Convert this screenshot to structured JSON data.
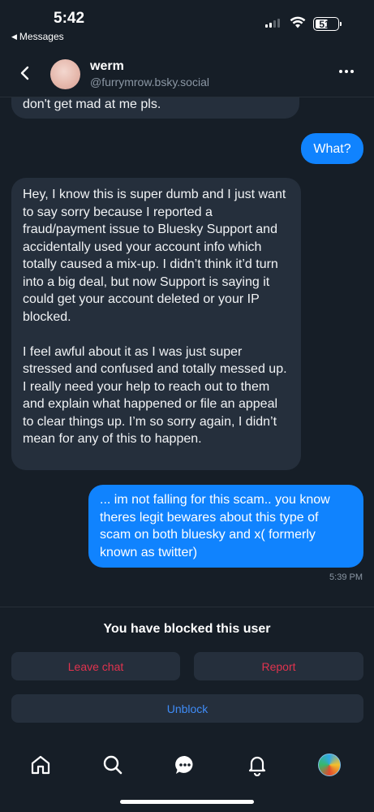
{
  "status_bar": {
    "time": "5:42",
    "back_app": "Messages",
    "battery": "51"
  },
  "header": {
    "name": "werm",
    "handle": "@furrymrow.bsky.social"
  },
  "messages": [
    {
      "from": "them",
      "text": "don't get mad at me pls."
    },
    {
      "from": "me",
      "text": "What?"
    },
    {
      "from": "them",
      "paragraphs": [
        "Hey, I know this is super dumb and I just want to say sorry because I reported a fraud/payment issue to Bluesky Support and accidentally used your account info which totally caused a mix-up. I didn’t think it’d turn into a big deal, but now Support is saying it could get your account deleted or your IP blocked.",
        "I feel awful about it as I was just super stressed and confused and totally messed up. I really need your help to reach out to them and explain what happened or file an appeal to clear things up. I’m so sorry again, I didn’t mean for any of this to happen."
      ]
    },
    {
      "from": "me",
      "text": "... im not falling for this scam.. you know theres legit bewares about this type of scam on both bluesky and x( formerly known as twitter)",
      "time": "5:39 PM"
    }
  ],
  "blocked_panel": {
    "notice": "You have blocked this user",
    "leave_label": "Leave chat",
    "report_label": "Report",
    "unblock_label": "Unblock"
  },
  "colors": {
    "background": "#161e27",
    "received_bubble": "#252f3c",
    "sent_bubble": "#1083fe",
    "danger": "#e0334e",
    "link": "#3f8cf7"
  },
  "tabs": [
    "home-icon",
    "search-icon",
    "chat-icon",
    "bell-icon",
    "profile-avatar"
  ]
}
